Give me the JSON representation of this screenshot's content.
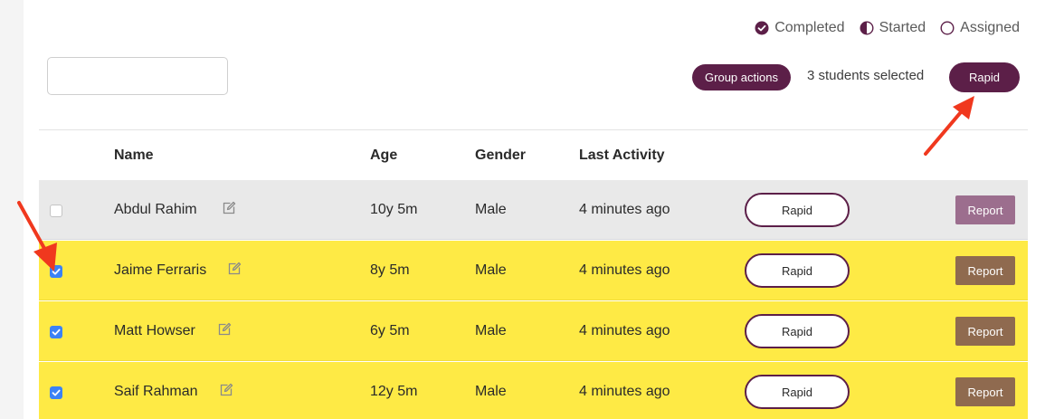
{
  "legend": {
    "completed": "Completed",
    "started": "Started",
    "assigned": "Assigned"
  },
  "search": {
    "value": "",
    "placeholder": ""
  },
  "toolbar": {
    "group_actions": "Group actions",
    "selected_count": "3 students selected",
    "rapid": "Rapid"
  },
  "table": {
    "columns": {
      "name": "Name",
      "age": "Age",
      "gender": "Gender",
      "last_activity": "Last Activity"
    },
    "rows": [
      {
        "checked": false,
        "name": "Abdul Rahim",
        "age": "10y 5m",
        "gender": "Male",
        "last_activity": "4 minutes ago",
        "rapid": "Rapid",
        "report": "Report"
      },
      {
        "checked": true,
        "name": "Jaime Ferraris",
        "age": "8y 5m",
        "gender": "Male",
        "last_activity": "4 minutes ago",
        "rapid": "Rapid",
        "report": "Report"
      },
      {
        "checked": true,
        "name": "Matt Howser",
        "age": "6y 5m",
        "gender": "Male",
        "last_activity": "4 minutes ago",
        "rapid": "Rapid",
        "report": "Report"
      },
      {
        "checked": true,
        "name": "Saif Rahman",
        "age": "12y 5m",
        "gender": "Male",
        "last_activity": "4 minutes ago",
        "rapid": "Rapid",
        "report": "Report"
      }
    ]
  },
  "colors": {
    "accent": "#5c1f48",
    "selected_row": "#feea45",
    "unselected_row": "#e9e9e9",
    "checkbox": "#3b82f6",
    "annotation_arrow": "#f0381e"
  }
}
